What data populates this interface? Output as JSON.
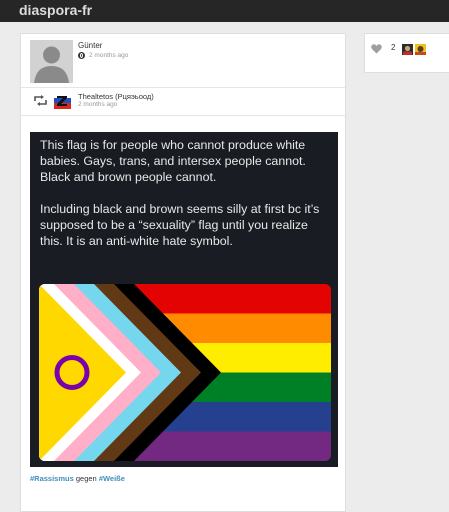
{
  "app": {
    "title": "diaspora-fr"
  },
  "post": {
    "author": "Günter",
    "time": "2 months ago",
    "reshare": {
      "author": "Thealtetos (Ρцяэьоод)",
      "time": "2 months ago"
    },
    "image_text": [
      "This flag is for people who cannot produce white babies. Gays, trans, and intersex people cannot. Black and brown people cannot.",
      "Including black and brown seems silly at first bc it’s supposed to be a “sexuality” flag until you realize this. It is an anti-white hate symbol."
    ],
    "tags": {
      "tag1": "#Rassismus",
      "middle": " gegen ",
      "tag2": "#Weiße"
    }
  },
  "likes": {
    "count": "2"
  },
  "colors": {
    "topbar": "#262626",
    "link": "#3f8fba",
    "image_bg": "#1a1c23",
    "rainbow": [
      "#e40303",
      "#ff8c00",
      "#ffed00",
      "#008026",
      "#24408e",
      "#732982"
    ],
    "chevrons": [
      "#000000",
      "#613915",
      "#74d7ee",
      "#ffafc8",
      "#ffffff"
    ],
    "intersex": [
      "#ffd800",
      "#7902aa"
    ]
  },
  "icons": [
    "globe-icon",
    "reshare-icon",
    "heart-icon"
  ]
}
